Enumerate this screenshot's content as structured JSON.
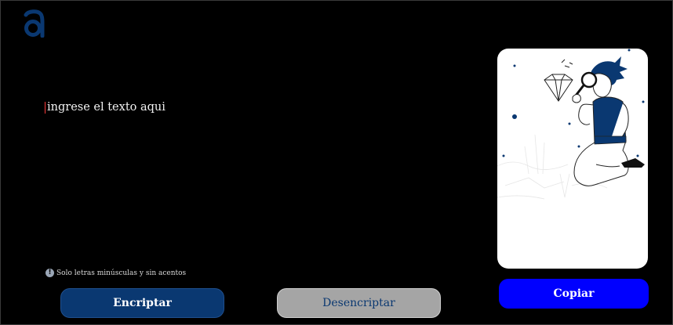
{
  "app": {
    "logo_icon": "alura-a-logo",
    "colors": {
      "background": "#000000",
      "primary": "#0a3871",
      "copy": "#0000ff",
      "disabled": "#a5a5a5"
    }
  },
  "input": {
    "placeholder": "ingrese el texto aqui",
    "value": ""
  },
  "hint": {
    "icon": "info-icon",
    "text": "Solo letras minúsculas y sin acentos"
  },
  "buttons": {
    "encrypt_label": "Encriptar",
    "decrypt_label": "Desencriptar",
    "copy_label": "Copiar"
  },
  "illustration": {
    "name": "person-with-magnifying-glass-and-diamond"
  }
}
